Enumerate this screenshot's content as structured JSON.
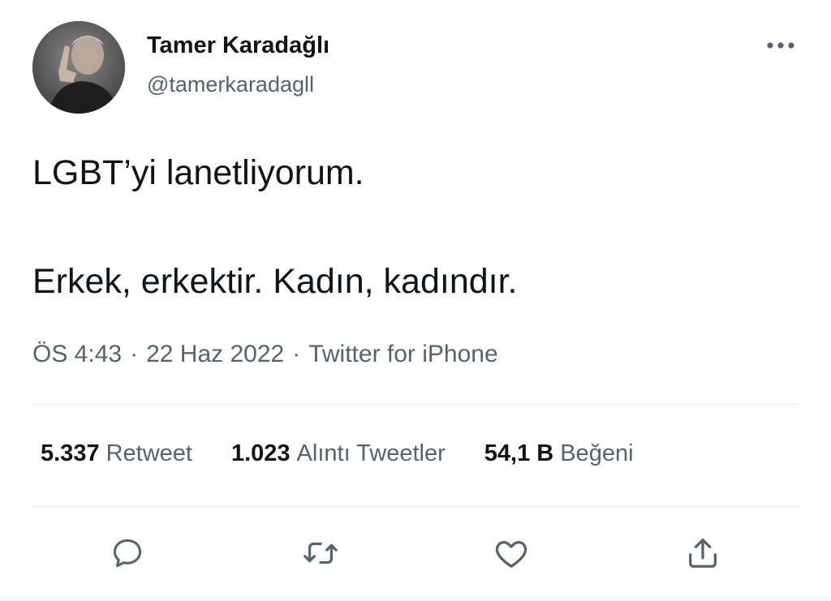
{
  "author": {
    "name": "Tamer Karadağlı",
    "handle": "@tamerkaradagll"
  },
  "tweet": {
    "line1": "LGBT’yi lanetliyorum.",
    "line2": "Erkek, erkektir. Kadın, kadındır."
  },
  "meta": {
    "time": "ÖS 4:43",
    "separator": "·",
    "date": "22 Haz 2022",
    "source": "Twitter for iPhone"
  },
  "stats": {
    "retweets": {
      "count": "5.337",
      "label": "Retweet"
    },
    "quotes": {
      "count": "1.023",
      "label": "Alıntı Tweetler"
    },
    "likes": {
      "count": "54,1 B",
      "label": "Beğeni"
    }
  },
  "icons": {
    "more": "more-horizontal-icon",
    "reply": "reply-icon",
    "retweet": "retweet-icon",
    "like": "heart-icon",
    "share": "share-icon"
  },
  "colors": {
    "text_primary": "#0f1419",
    "text_secondary": "#536471",
    "divider": "#e6ebee"
  }
}
